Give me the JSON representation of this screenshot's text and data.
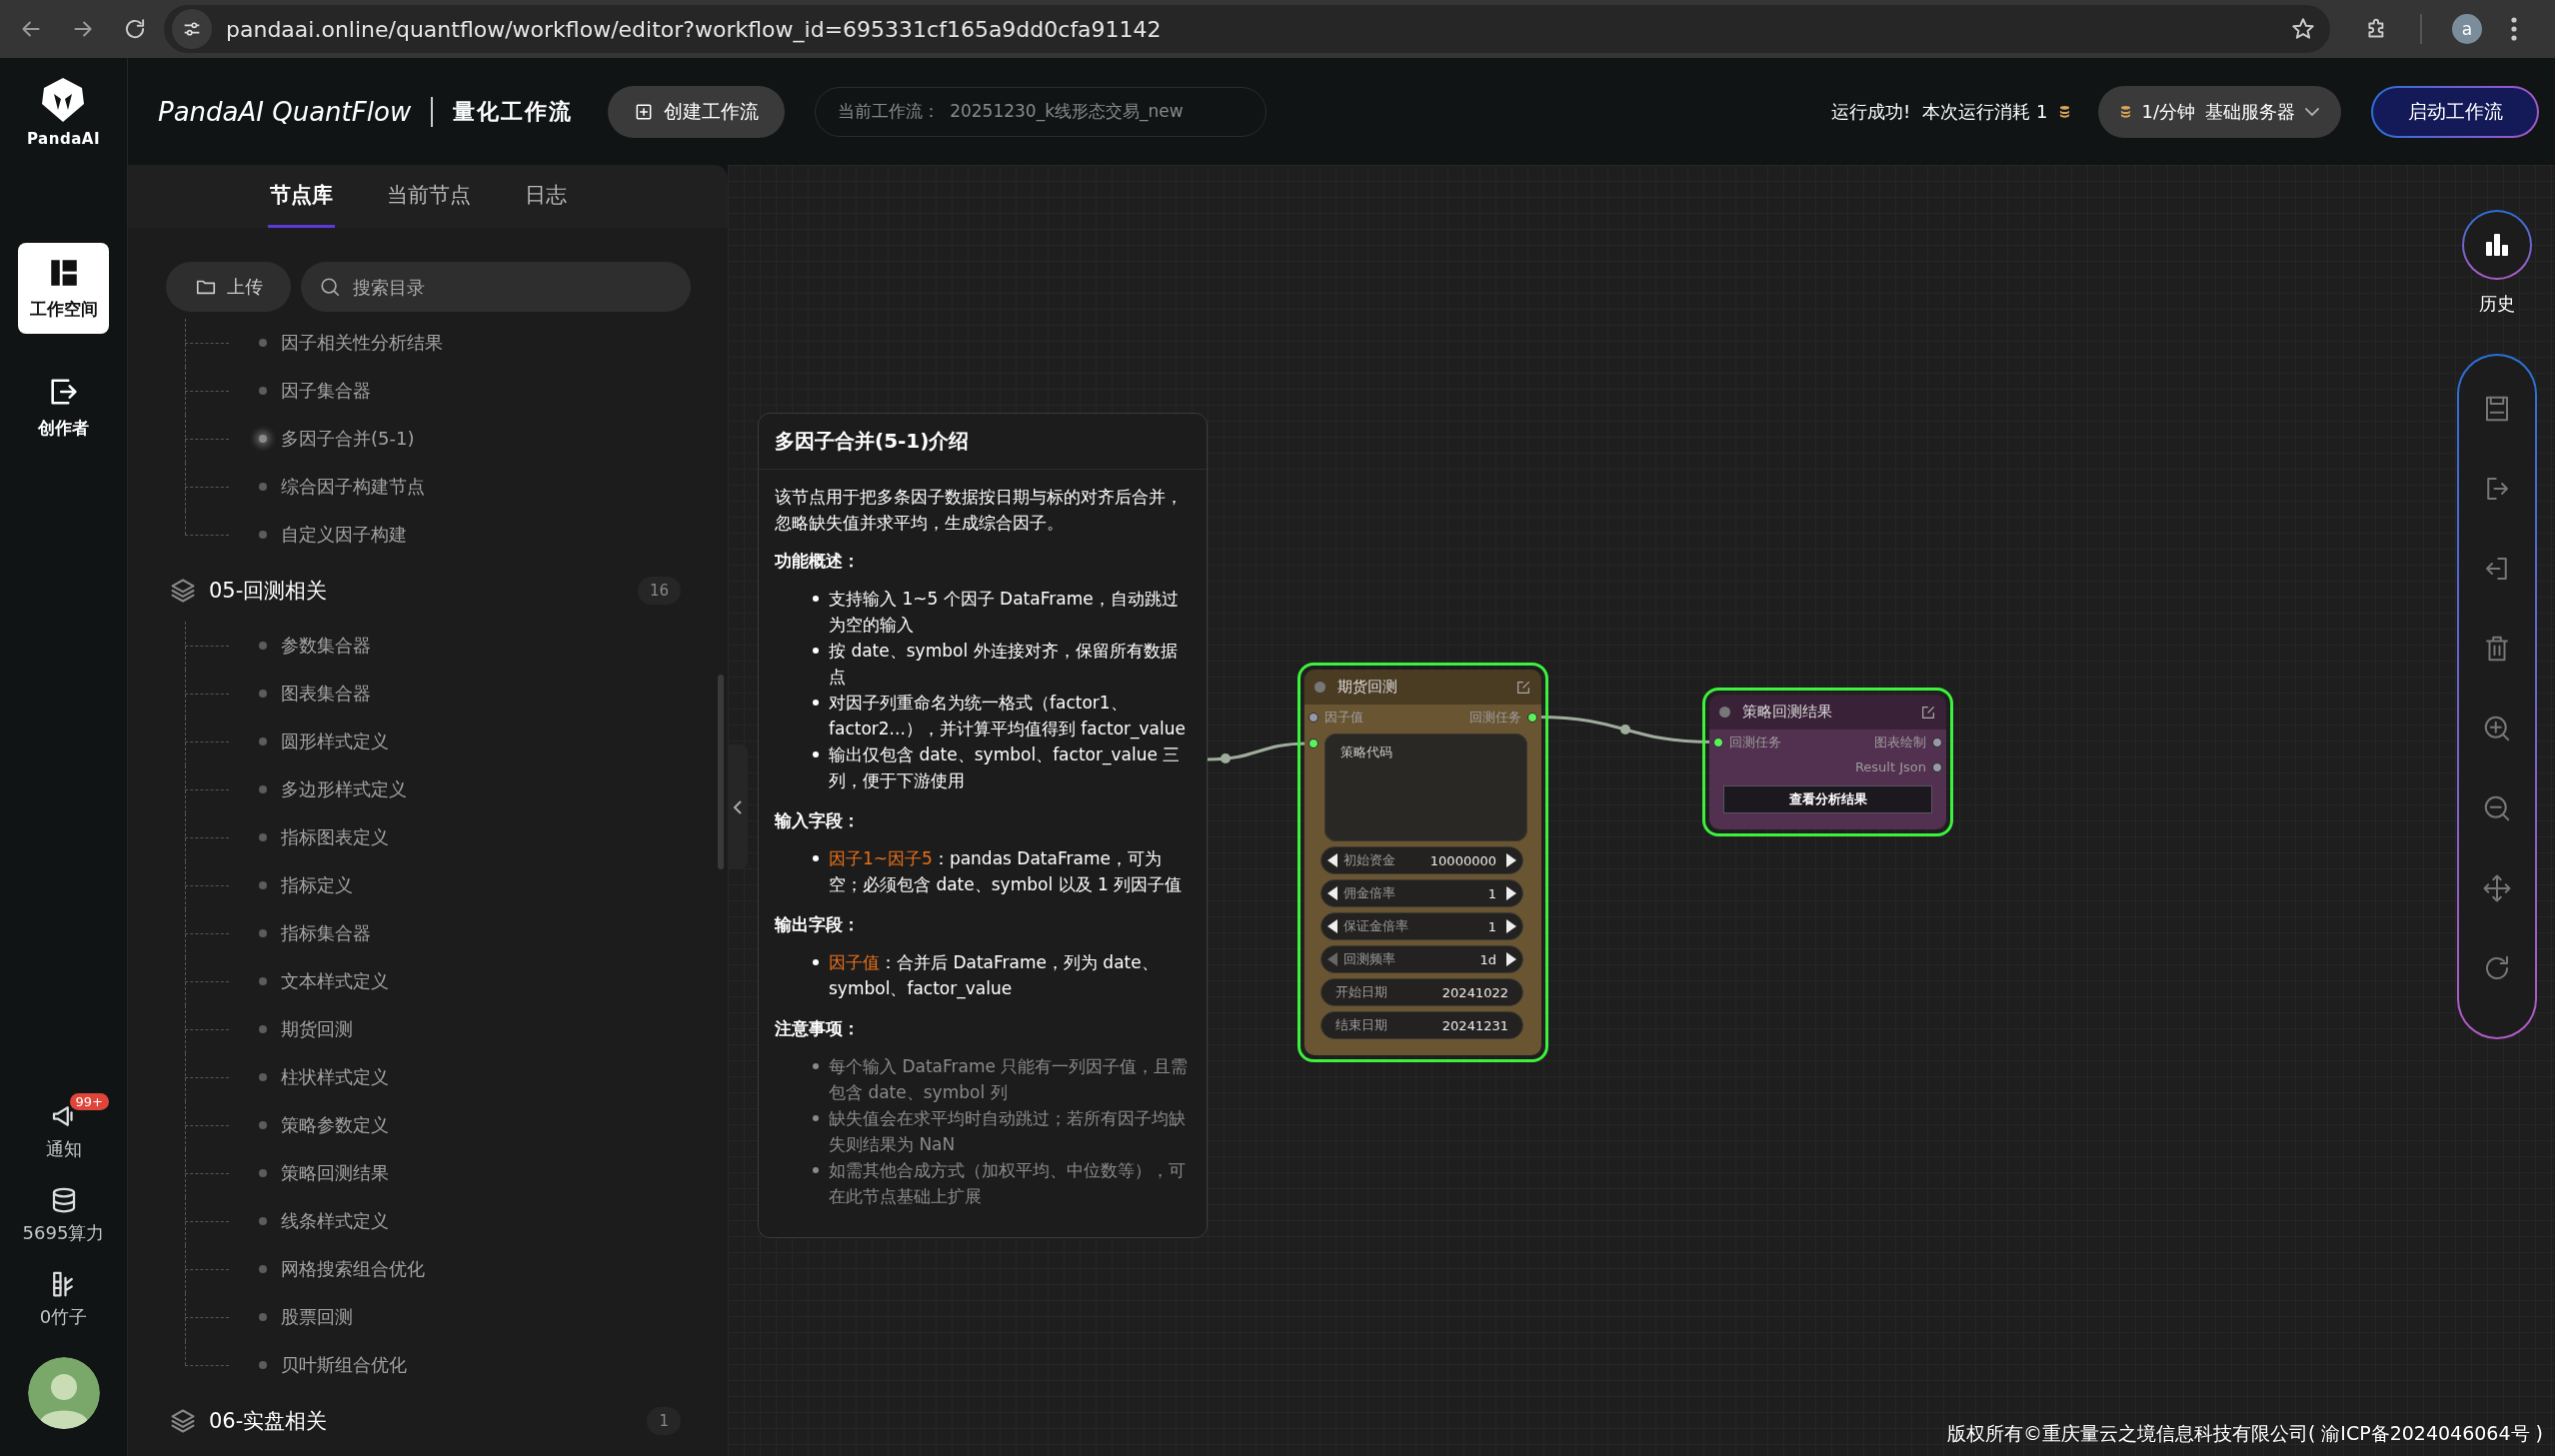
{
  "browser": {
    "url": "pandaai.online/quantflow/workflow/editor?workflow_id=695331cf165a9dd0cfa91142",
    "profile_initial": "a"
  },
  "rail": {
    "logo_text": "PandaAI",
    "nav": [
      {
        "kind": "workspace",
        "label": "工作空间",
        "selected": true
      },
      {
        "kind": "creator",
        "label": "创作者",
        "selected": false
      }
    ],
    "stats": [
      {
        "kind": "notify",
        "label": "通知",
        "badge": "99+"
      },
      {
        "kind": "compute",
        "label": "5695算力"
      },
      {
        "kind": "bamboo",
        "label": "0竹子"
      }
    ]
  },
  "header": {
    "title": "PandaAI QuantFlow",
    "subtitle": "量化工作流",
    "create_button": "创建工作流",
    "current_workflow": {
      "label": "当前工作流：",
      "value": "20251230_k线形态交易_new"
    },
    "status": "运行成功!",
    "cost": "本次运行消耗 1",
    "server": {
      "rate": "1/分钟",
      "name": "基础服务器"
    },
    "start_button": "启动工作流"
  },
  "panel": {
    "tabs": [
      {
        "label": "节点库",
        "selected": true
      },
      {
        "label": "当前节点",
        "selected": false
      },
      {
        "label": "日志",
        "selected": false
      }
    ],
    "upload_button": "上传",
    "search": {
      "placeholder": "搜索目录"
    },
    "groups": [
      {
        "children": [
          {
            "label": "因子相关性分析结果",
            "selected": false
          },
          {
            "label": "因子集合器",
            "selected": false
          },
          {
            "label": "多因子合并(5-1)",
            "selected": true
          },
          {
            "label": "综合因子构建节点",
            "selected": false
          },
          {
            "label": "自定义因子构建",
            "selected": false
          }
        ]
      },
      {
        "label": "05-回测相关",
        "count": "16",
        "children": [
          {
            "label": "参数集合器",
            "selected": false
          },
          {
            "label": "图表集合器",
            "selected": false
          },
          {
            "label": "圆形样式定义",
            "selected": false
          },
          {
            "label": "多边形样式定义",
            "selected": false
          },
          {
            "label": "指标图表定义",
            "selected": false
          },
          {
            "label": "指标定义",
            "selected": false
          },
          {
            "label": "指标集合器",
            "selected": false
          },
          {
            "label": "文本样式定义",
            "selected": false
          },
          {
            "label": "期货回测",
            "selected": false
          },
          {
            "label": "柱状样式定义",
            "selected": false
          },
          {
            "label": "策略参数定义",
            "selected": false
          },
          {
            "label": "策略回测结果",
            "selected": false
          },
          {
            "label": "线条样式定义",
            "selected": false
          },
          {
            "label": "网格搜索组合优化",
            "selected": false
          },
          {
            "label": "股票回测",
            "selected": false
          },
          {
            "label": "贝叶斯组合优化",
            "selected": false
          }
        ]
      },
      {
        "label": "06-实盘相关",
        "count": "1"
      }
    ]
  },
  "popup": {
    "title": "多因子合并(5-1)介绍",
    "intro": "该节点用于把多条因子数据按日期与标的对齐后合并，忽略缺失值并求平均，生成综合因子。",
    "sections": [
      {
        "heading": "功能概述：",
        "muted": false,
        "items": [
          {
            "text": "支持输入 1~5 个因子 DataFrame，自动跳过为空的输入"
          },
          {
            "text": "按 date、symbol 外连接对齐，保留所有数据点"
          },
          {
            "text": "对因子列重命名为统一格式（factor1、factor2...），并计算平均值得到 factor_value"
          },
          {
            "text": "输出仅包含 date、symbol、factor_value 三列，便于下游使用"
          }
        ]
      },
      {
        "heading": "输入字段：",
        "muted": false,
        "items": [
          {
            "term": "因子1~因子5",
            "text": "：pandas DataFrame，可为空；必须包含 date、symbol 以及 1 列因子值"
          }
        ]
      },
      {
        "heading": "输出字段：",
        "muted": false,
        "items": [
          {
            "term": "因子值",
            "text": "：合并后 DataFrame，列为 date、symbol、factor_value"
          }
        ]
      },
      {
        "heading": "注意事项：",
        "muted": true,
        "items": [
          {
            "text": "每个输入 DataFrame 只能有一列因子值，且需包含 date、symbol 列"
          },
          {
            "text": "缺失值会在求平均时自动跳过；若所有因子均缺失则结果为 NaN"
          },
          {
            "text": "如需其他合成方式（加权平均、中位数等），可在此节点基础上扩展"
          }
        ]
      }
    ]
  },
  "nodes": [
    {
      "title": "期货回测",
      "color": "#6a5533",
      "selected": true,
      "inputs": [
        {
          "label": "因子值",
          "connected": false
        }
      ],
      "outputs": [
        {
          "label": "回测任务",
          "connected": true
        }
      ],
      "code": {
        "label": "策略代码",
        "connected": true
      },
      "widgets": [
        {
          "kind": "number",
          "label": "初始资金",
          "value": "10000000",
          "at_min": false
        },
        {
          "kind": "number",
          "label": "佣金倍率",
          "value": "1",
          "at_min": false
        },
        {
          "kind": "number",
          "label": "保证金倍率",
          "value": "1",
          "at_min": false
        },
        {
          "kind": "number",
          "label": "回测频率",
          "value": "1d",
          "at_min": true
        },
        {
          "kind": "text",
          "label": "开始日期",
          "value": "20241022"
        },
        {
          "kind": "text",
          "label": "结束日期",
          "value": "20241231"
        }
      ]
    },
    {
      "title": "策略回测结果",
      "color": "#52304f",
      "selected": true,
      "inputs": [
        {
          "label": "回测任务",
          "connected": true
        }
      ],
      "outputs": [
        {
          "label": "图表绘制",
          "connected": false
        },
        {
          "label": "Result Json",
          "connected": false
        }
      ],
      "button": "查看分析结果"
    }
  ],
  "toolbar": {
    "history_label": "历史",
    "tools": [
      {
        "kind": "save"
      },
      {
        "kind": "export"
      },
      {
        "kind": "import"
      },
      {
        "kind": "delete"
      },
      {
        "kind": "zoom_in"
      },
      {
        "kind": "zoom_out"
      },
      {
        "kind": "move"
      },
      {
        "kind": "refresh"
      }
    ]
  },
  "footer": "版权所有©重庆量云之境信息科技有限公司( 渝ICP备2024046064号 )"
}
